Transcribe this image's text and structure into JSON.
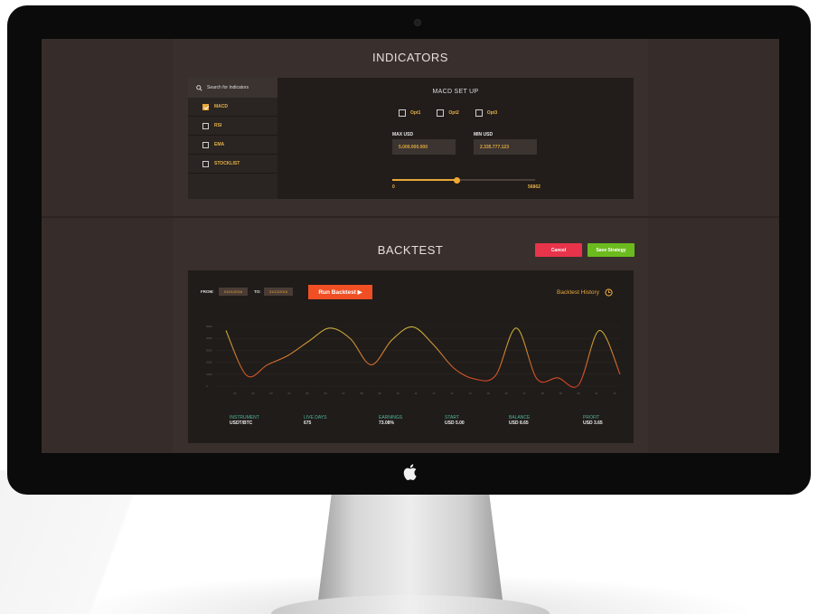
{
  "indicators": {
    "title": "INDICATORS",
    "search_placeholder": "Search for Indicators",
    "items": [
      {
        "label": "MACD",
        "checked": true
      },
      {
        "label": "RSI",
        "checked": false
      },
      {
        "label": "EMA",
        "checked": false
      },
      {
        "label": "STOCKLIST",
        "checked": false
      }
    ],
    "setup": {
      "title": "MACD SET UP",
      "options": [
        "Opt1",
        "Opt2",
        "Opt3"
      ],
      "max_label": "MAX USD",
      "max_value": "5.000.000.000",
      "min_label": "MIN USD",
      "min_value": "2.335.777.123",
      "slider": {
        "min": "0",
        "max": "56862",
        "fraction": 0.45
      }
    }
  },
  "backtest": {
    "title": "BACKTEST",
    "cancel_label": "Cancel",
    "save_label": "Save Strategy",
    "from_label": "FROM:",
    "from_value": "01/01/2016",
    "to_label": "TO:",
    "to_value": "31/12/2016",
    "run_label": "Run Backtest ▶",
    "history_label": "Backtest History",
    "stats": [
      {
        "label": "INSTRUMENT",
        "value": "USDT/BTC"
      },
      {
        "label": "LIVE DAYS",
        "value": "675"
      },
      {
        "label": "EARNINGS",
        "value": "73.08%"
      },
      {
        "label": "START",
        "value": "USD 5.00"
      },
      {
        "label": "BALANCE",
        "value": "USD 8.65"
      },
      {
        "label": "PROFIT",
        "value": "USD 3.65"
      }
    ]
  },
  "chart_data": {
    "type": "line",
    "y_ticks": [
      "0",
      "100k",
      "200k",
      "300k",
      "400k",
      "500k"
    ],
    "x_ticks": [
      "01",
      "02",
      "03",
      "04",
      "05",
      "06",
      "07",
      "08",
      "09",
      "10",
      "11",
      "12",
      "13",
      "14",
      "15",
      "16",
      "17",
      "18",
      "19",
      "20",
      "21",
      "22"
    ],
    "series": [
      {
        "values": [
          470,
          90,
          180,
          260,
          380,
          490,
          400,
          180,
          390,
          500,
          350,
          150,
          60,
          90,
          490,
          60,
          70,
          10,
          470,
          100
        ]
      }
    ],
    "ylim": [
      0,
      550
    ],
    "grid": true,
    "colors": {
      "low": "#d33b23",
      "high": "#c9b53a"
    }
  },
  "colors": {
    "accent": "#e8a73a",
    "cancel": "#e8344a",
    "save": "#6cbb1e",
    "run": "#f04f24",
    "stat_label": "#4fb59b"
  }
}
